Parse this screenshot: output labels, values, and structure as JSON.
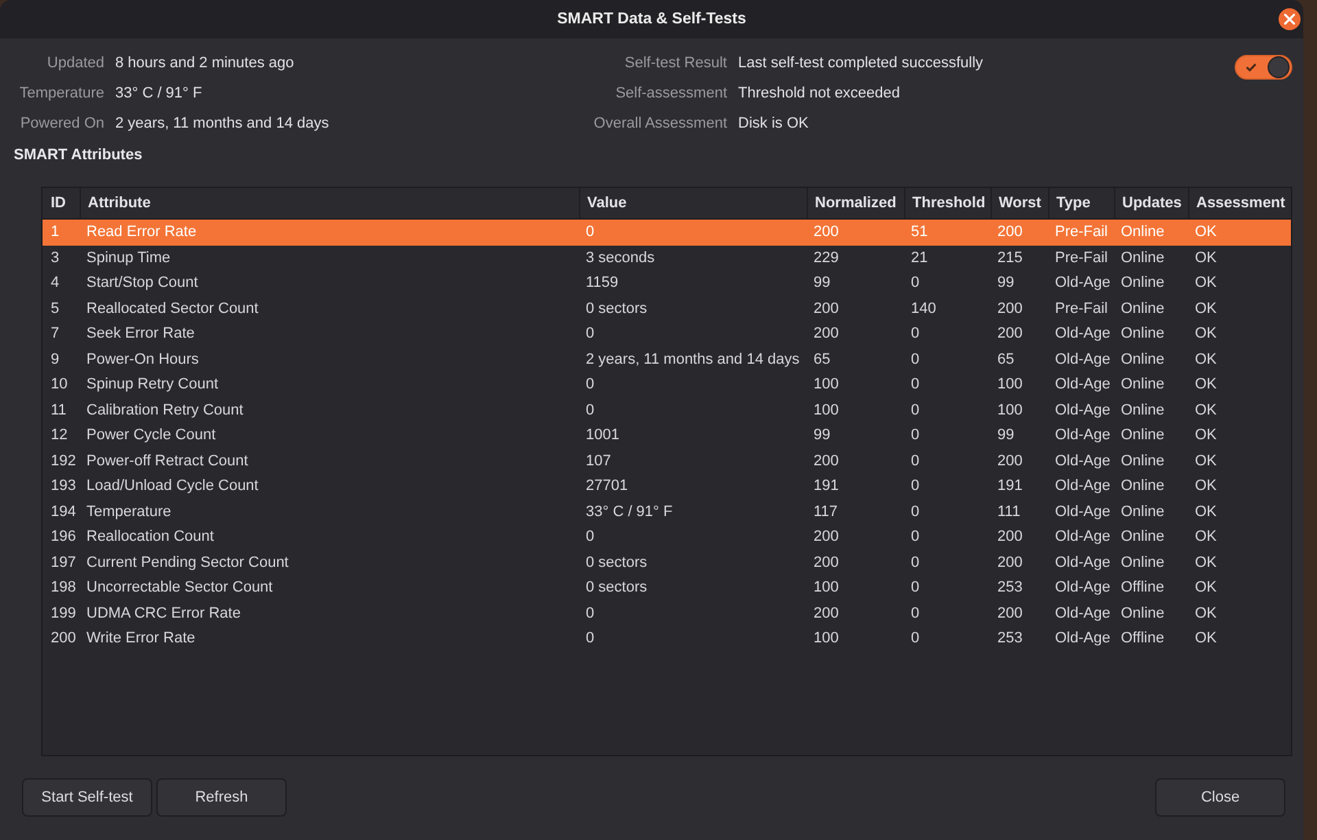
{
  "window": {
    "title": "SMART Data & Self-Tests"
  },
  "info": {
    "left": [
      {
        "label": "Updated",
        "value": "8 hours and 2 minutes ago"
      },
      {
        "label": "Temperature",
        "value": "33° C / 91° F"
      },
      {
        "label": "Powered On",
        "value": "2 years, 11 months and 14 days"
      }
    ],
    "right": [
      {
        "label": "Self-test Result",
        "value": "Last self-test completed successfully"
      },
      {
        "label": "Self-assessment",
        "value": "Threshold not exceeded"
      },
      {
        "label": "Overall Assessment",
        "value": "Disk is OK"
      }
    ]
  },
  "toggle": {
    "on": true
  },
  "section_title": "SMART Attributes",
  "table": {
    "columns": [
      "ID",
      "Attribute",
      "Value",
      "Normalized",
      "Threshold",
      "Worst",
      "Type",
      "Updates",
      "Assessment"
    ],
    "rows": [
      {
        "selected": true,
        "cells": [
          "1",
          "Read Error Rate",
          "0",
          "200",
          "51",
          "200",
          "Pre-Fail",
          "Online",
          "OK"
        ]
      },
      {
        "selected": false,
        "cells": [
          "3",
          "Spinup Time",
          "3 seconds",
          "229",
          "21",
          "215",
          "Pre-Fail",
          "Online",
          "OK"
        ]
      },
      {
        "selected": false,
        "cells": [
          "4",
          "Start/Stop Count",
          "1159",
          "99",
          "0",
          "99",
          "Old-Age",
          "Online",
          "OK"
        ]
      },
      {
        "selected": false,
        "cells": [
          "5",
          "Reallocated Sector Count",
          "0 sectors",
          "200",
          "140",
          "200",
          "Pre-Fail",
          "Online",
          "OK"
        ]
      },
      {
        "selected": false,
        "cells": [
          "7",
          "Seek Error Rate",
          "0",
          "200",
          "0",
          "200",
          "Old-Age",
          "Online",
          "OK"
        ]
      },
      {
        "selected": false,
        "cells": [
          "9",
          "Power-On Hours",
          "2 years, 11 months and 14 days",
          "65",
          "0",
          "65",
          "Old-Age",
          "Online",
          "OK"
        ]
      },
      {
        "selected": false,
        "cells": [
          "10",
          "Spinup Retry Count",
          "0",
          "100",
          "0",
          "100",
          "Old-Age",
          "Online",
          "OK"
        ]
      },
      {
        "selected": false,
        "cells": [
          "11",
          "Calibration Retry Count",
          "0",
          "100",
          "0",
          "100",
          "Old-Age",
          "Online",
          "OK"
        ]
      },
      {
        "selected": false,
        "cells": [
          "12",
          "Power Cycle Count",
          "1001",
          "99",
          "0",
          "99",
          "Old-Age",
          "Online",
          "OK"
        ]
      },
      {
        "selected": false,
        "cells": [
          "192",
          "Power-off Retract Count",
          "107",
          "200",
          "0",
          "200",
          "Old-Age",
          "Online",
          "OK"
        ]
      },
      {
        "selected": false,
        "cells": [
          "193",
          "Load/Unload Cycle Count",
          "27701",
          "191",
          "0",
          "191",
          "Old-Age",
          "Online",
          "OK"
        ]
      },
      {
        "selected": false,
        "cells": [
          "194",
          "Temperature",
          "33° C / 91° F",
          "117",
          "0",
          "111",
          "Old-Age",
          "Online",
          "OK"
        ]
      },
      {
        "selected": false,
        "cells": [
          "196",
          "Reallocation Count",
          "0",
          "200",
          "0",
          "200",
          "Old-Age",
          "Online",
          "OK"
        ]
      },
      {
        "selected": false,
        "cells": [
          "197",
          "Current Pending Sector Count",
          "0 sectors",
          "200",
          "0",
          "200",
          "Old-Age",
          "Online",
          "OK"
        ]
      },
      {
        "selected": false,
        "cells": [
          "198",
          "Uncorrectable Sector Count",
          "0 sectors",
          "100",
          "0",
          "253",
          "Old-Age",
          "Offline",
          "OK"
        ]
      },
      {
        "selected": false,
        "cells": [
          "199",
          "UDMA CRC Error Rate",
          "0",
          "200",
          "0",
          "200",
          "Old-Age",
          "Online",
          "OK"
        ]
      },
      {
        "selected": false,
        "cells": [
          "200",
          "Write Error Rate",
          "0",
          "100",
          "0",
          "253",
          "Old-Age",
          "Offline",
          "OK"
        ]
      }
    ]
  },
  "footer": {
    "left_buttons": [
      "Start Self-test",
      "Refresh"
    ],
    "right_buttons": [
      "Close"
    ]
  }
}
